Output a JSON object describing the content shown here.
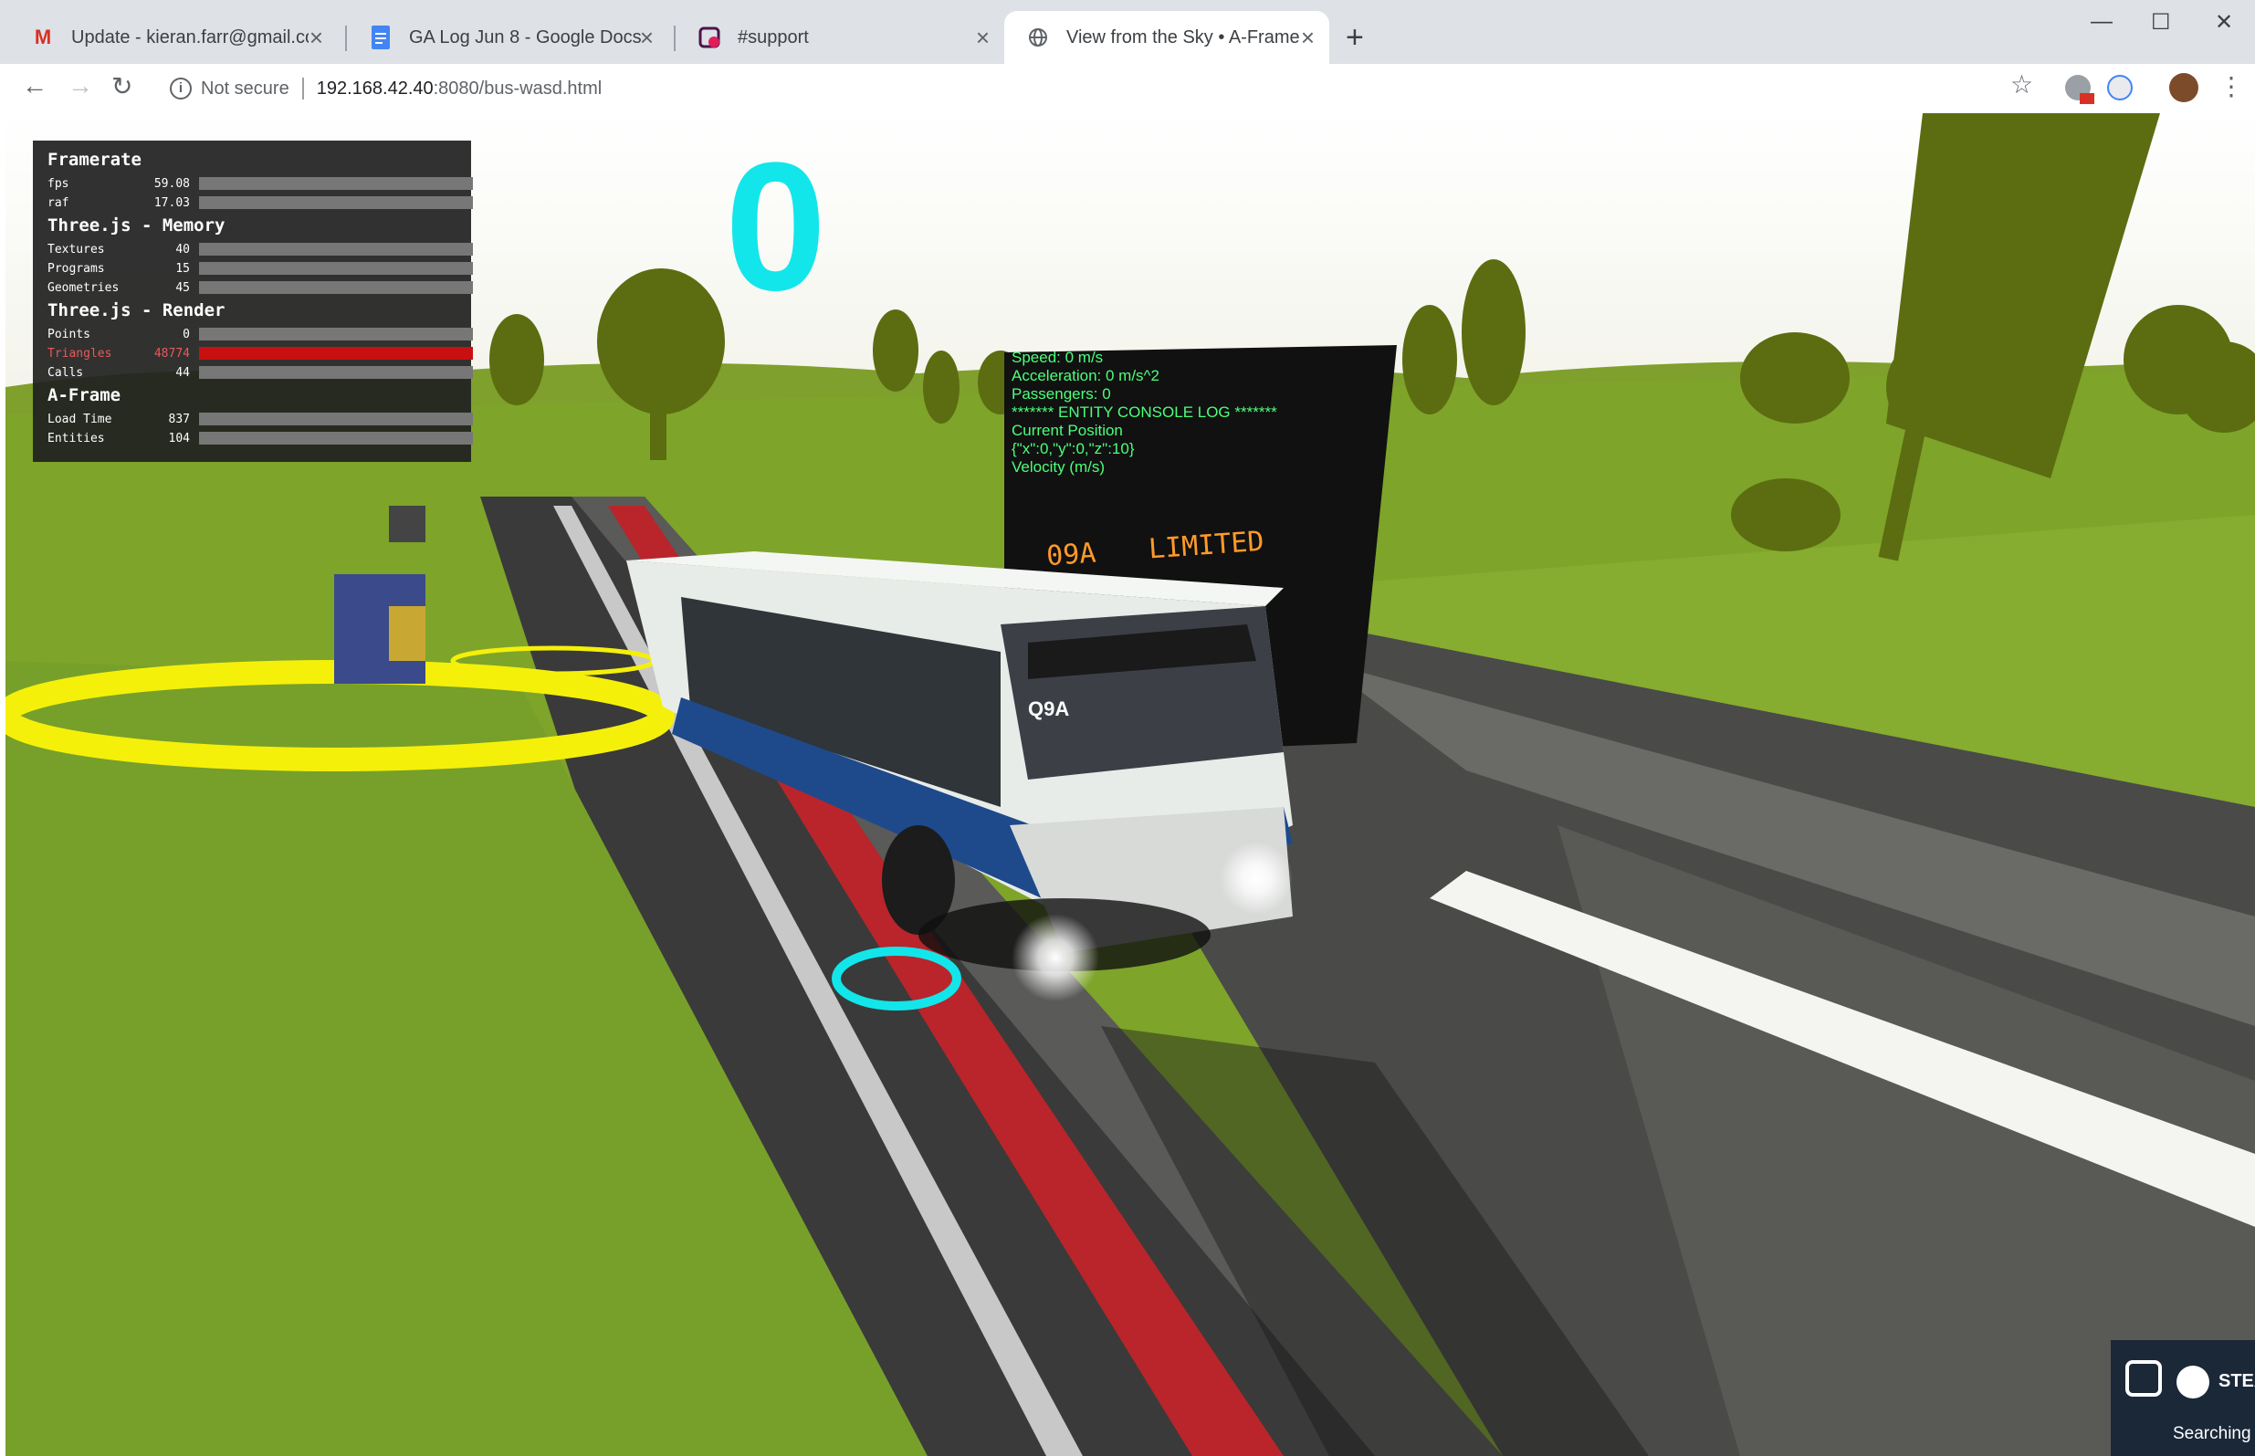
{
  "tabs": [
    {
      "title": "Update - kieran.farr@gmail.com",
      "icon": "gmail-icon"
    },
    {
      "title": "GA Log Jun 8 - Google Docs",
      "icon": "google-docs-icon"
    },
    {
      "title": "#support",
      "icon": "slack-icon"
    },
    {
      "title": "View from the Sky • A-Frame",
      "icon": "globe-icon",
      "active": true
    }
  ],
  "toolbar": {
    "security": "Not secure",
    "url_host": "192.168.42.40",
    "url_path": ":8080/bus-wasd.html"
  },
  "stats": {
    "framerate_title": "Framerate",
    "fps": {
      "label": "fps",
      "value": "59.08"
    },
    "raf": {
      "label": "raf",
      "value": "17.03"
    },
    "memory_title": "Three.js - Memory",
    "textures": {
      "label": "Textures",
      "value": "40"
    },
    "programs": {
      "label": "Programs",
      "value": "15"
    },
    "geometries": {
      "label": "Geometries",
      "value": "45"
    },
    "render_title": "Three.js - Render",
    "points": {
      "label": "Points",
      "value": "0"
    },
    "triangles": {
      "label": "Triangles",
      "value": "48774"
    },
    "calls": {
      "label": "Calls",
      "value": "44"
    },
    "aframe_title": "A-Frame",
    "loadtime": {
      "label": "Load Time",
      "value": "837"
    },
    "entities": {
      "label": "Entities",
      "value": "104"
    }
  },
  "scene": {
    "counter": "0",
    "bus_sign_route": "09A",
    "bus_sign_text": "LIMITED",
    "bus_route_label": "Q9A",
    "console_lines": [
      "Speed: 0 m/s",
      "Acceleration: 0 m/s^2",
      "Passengers: 0",
      "******* ENTITY CONSOLE LOG *******",
      "Current Position",
      "{\"x\":0,\"y\":0,\"z\":10}",
      "Velocity (m/s)"
    ]
  },
  "steam": {
    "name": "STEA",
    "status": "Searching"
  }
}
